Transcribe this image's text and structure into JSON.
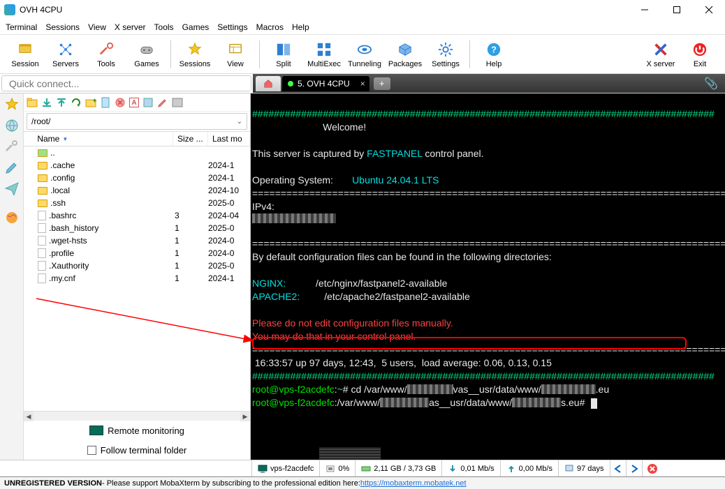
{
  "window": {
    "title": "OVH 4CPU"
  },
  "menu": [
    "Terminal",
    "Sessions",
    "View",
    "X server",
    "Tools",
    "Games",
    "Settings",
    "Macros",
    "Help"
  ],
  "toolbar": [
    {
      "label": "Session",
      "color": "#f2c720"
    },
    {
      "label": "Servers",
      "color": "#2d7fd3"
    },
    {
      "label": "Tools",
      "color": "#e25b4a"
    },
    {
      "label": "Games",
      "color": "#8a8a8a"
    },
    {
      "label": "Sessions",
      "color": "#f2c720"
    },
    {
      "label": "View",
      "color": "#f2c720"
    },
    {
      "label": "Split",
      "color": "#2d7fd3"
    },
    {
      "label": "MultiExec",
      "color": "#2d7fd3"
    },
    {
      "label": "Tunneling",
      "color": "#2d7fd3"
    },
    {
      "label": "Packages",
      "color": "#2d7fd3"
    },
    {
      "label": "Settings",
      "color": "#2d7fd3"
    },
    {
      "label": "Help",
      "color": "#2d7fd3"
    }
  ],
  "toolbar_right": [
    {
      "label": "X server",
      "color": "#000"
    },
    {
      "label": "Exit",
      "color": "#e22"
    }
  ],
  "quick_placeholder": "Quick connect...",
  "tab": {
    "index": "5.",
    "name": "OVH 4CPU"
  },
  "sftp_path": "/root/",
  "columns": {
    "name": "Name",
    "size": "Size ...",
    "mod": "Last mo"
  },
  "files": [
    {
      "name": "..",
      "type": "up",
      "size": "",
      "mod": ""
    },
    {
      "name": ".cache",
      "type": "d",
      "size": "",
      "mod": "2024-1"
    },
    {
      "name": ".config",
      "type": "d",
      "size": "",
      "mod": "2024-1"
    },
    {
      "name": ".local",
      "type": "d",
      "size": "",
      "mod": "2024-10"
    },
    {
      "name": ".ssh",
      "type": "d",
      "size": "",
      "mod": "2025-0"
    },
    {
      "name": ".bashrc",
      "type": "f",
      "size": "3",
      "mod": "2024-04"
    },
    {
      "name": ".bash_history",
      "type": "f",
      "size": "1",
      "mod": "2025-0"
    },
    {
      "name": ".wget-hsts",
      "type": "f",
      "size": "1",
      "mod": "2024-0"
    },
    {
      "name": ".profile",
      "type": "f",
      "size": "1",
      "mod": "2024-0"
    },
    {
      "name": ".Xauthority",
      "type": "f",
      "size": "1",
      "mod": "2025-0"
    },
    {
      "name": ".my.cnf",
      "type": "f",
      "size": "1",
      "mod": "2024-1"
    }
  ],
  "remote_monitoring": "Remote monitoring",
  "follow_terminal": "Follow terminal folder",
  "terminal": {
    "welcome": "Welcome!",
    "captured_pre": "This server is captured by ",
    "captured_link": "FASTPANEL",
    "captured_post": " control panel.",
    "os_label": "Operating System:",
    "os_value": "Ubuntu 24.04.1 LTS",
    "ipv4": "IPv4:",
    "conf_msg": "By default configuration files can be found in the following directories:",
    "nginx_l": "NGINX:",
    "nginx_p": "/etc/nginx/fastpanel2-available",
    "apache_l": "APACHE2:",
    "apache_p": "/etc/apache2/fastpanel2-available",
    "warn1": "Please do not edit configuration files manually.",
    "warn2": "You may do that in your control panel.",
    "uptime": " 16:33:57 up 97 days, 12:43,  5 users,  load average: 0.06, 0.13, 0.15",
    "prompt1_user": "root@vps-f2acdefc",
    "prompt1_path": "~",
    "prompt1_sep": ":",
    "prompt1_hash": "#",
    "prompt1_cmd_a": " cd /var/www/",
    "prompt1_cmd_b": "vas__usr/data/www/",
    "prompt1_cmd_c": ".eu",
    "prompt2_path_a": ":/var/www/",
    "prompt2_path_b": "as__usr/data/www/",
    "prompt2_path_c": "s.eu#"
  },
  "status": {
    "host": "vps-f2acdefc",
    "cpu": "0%",
    "mem": "2,11 GB / 3,73 GB",
    "down": "0,01 Mb/s",
    "up": "0,00 Mb/s",
    "uptime": "97 days"
  },
  "footer": {
    "unreg": "UNREGISTERED VERSION",
    "msg": " - Please support MobaXterm by subscribing to the professional edition here: ",
    "link": "https://mobaxterm.mobatek.net"
  }
}
